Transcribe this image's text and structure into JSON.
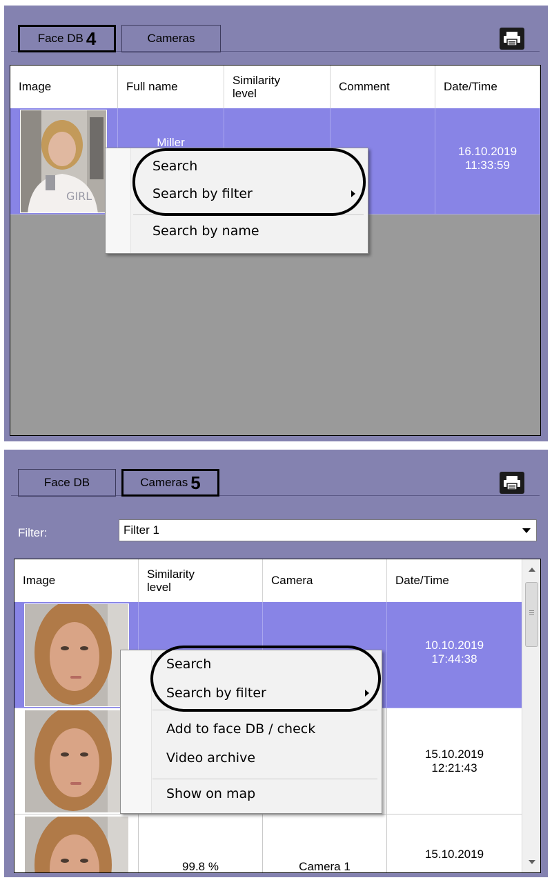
{
  "panel1": {
    "tabs": [
      {
        "label": "Face DB",
        "badge": "4"
      },
      {
        "label": "Cameras"
      }
    ],
    "columns": [
      "Image",
      "Full name",
      "Similarity\nlevel",
      "Comment",
      "Date/Time"
    ],
    "row": {
      "name": "Miller",
      "date": "16.10.2019",
      "time": "11:33:59"
    },
    "menu": {
      "search": "Search",
      "search_by_filter": "Search by filter",
      "search_by_name": "Search by name"
    }
  },
  "panel2": {
    "tabs": [
      {
        "label": "Face DB"
      },
      {
        "label": "Cameras",
        "badge": "5"
      }
    ],
    "filter_label": "Filter:",
    "filter_value": "Filter 1",
    "columns": [
      "Image",
      "Similarity\nlevel",
      "Camera",
      "Date/Time"
    ],
    "rows": [
      {
        "similarity": "",
        "camera": "",
        "date": "10.10.2019",
        "time": "17:44:38"
      },
      {
        "similarity": "",
        "camera": "",
        "date": "15.10.2019",
        "time": "12:21:43"
      },
      {
        "similarity": "99.8 %",
        "camera": "Camera 1",
        "date": "15.10.2019",
        "time": ""
      }
    ],
    "menu": {
      "search": "Search",
      "search_by_filter": "Search by filter",
      "add_to_face_db": "Add to face DB / check",
      "video_archive": "Video archive",
      "show_on_map": "Show on map"
    }
  },
  "colors": {
    "panel_bg": "#8482b0",
    "selection": "#8884e6",
    "grid_empty": "#9a9a9a"
  }
}
